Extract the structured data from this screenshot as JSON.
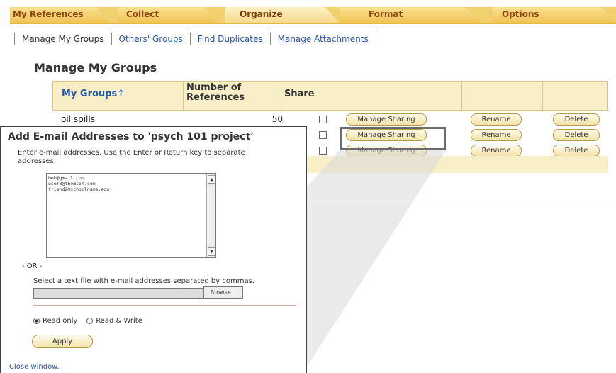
{
  "top_tabs": [
    "My References",
    "Collect",
    "Organize",
    "Format",
    "Options"
  ],
  "sub_tabs": [
    "Manage My Groups",
    "Others' Groups",
    "Find Duplicates",
    "Manage Attachments"
  ],
  "page_title": "Manage My Groups",
  "table": {
    "col_groups": "My Groups↑",
    "col_number": "Number of References",
    "col_share": "Share",
    "rows": [
      {
        "name": "oil spills",
        "count": "50"
      },
      {
        "name": "",
        "count": ""
      },
      {
        "name": "",
        "count": ""
      }
    ],
    "manage_sharing_label": "Manage Sharing",
    "rename_label": "Rename",
    "delete_label": "Delete"
  },
  "dialog": {
    "title": "Add E-mail Addresses to 'psych 101 project'",
    "description": "Enter e-mail addresses. Use the Enter or Return key to separate addresses.",
    "emails": [
      "bob@gmail.com",
      "user3@thomson.com",
      "friend2@schoolname.edu"
    ],
    "or_label": "- OR -",
    "select_label": "Select a text file with e-mail addresses separated by commas.",
    "browse_label": "Browse...",
    "radio_read_only": "Read only",
    "radio_read_write": "Read & Write",
    "apply_label": "Apply",
    "close_label": "Close window."
  },
  "colors": {
    "tab_bar": "#f3d06e",
    "link": "#2a58a8",
    "header_fill": "#f8eec8"
  }
}
